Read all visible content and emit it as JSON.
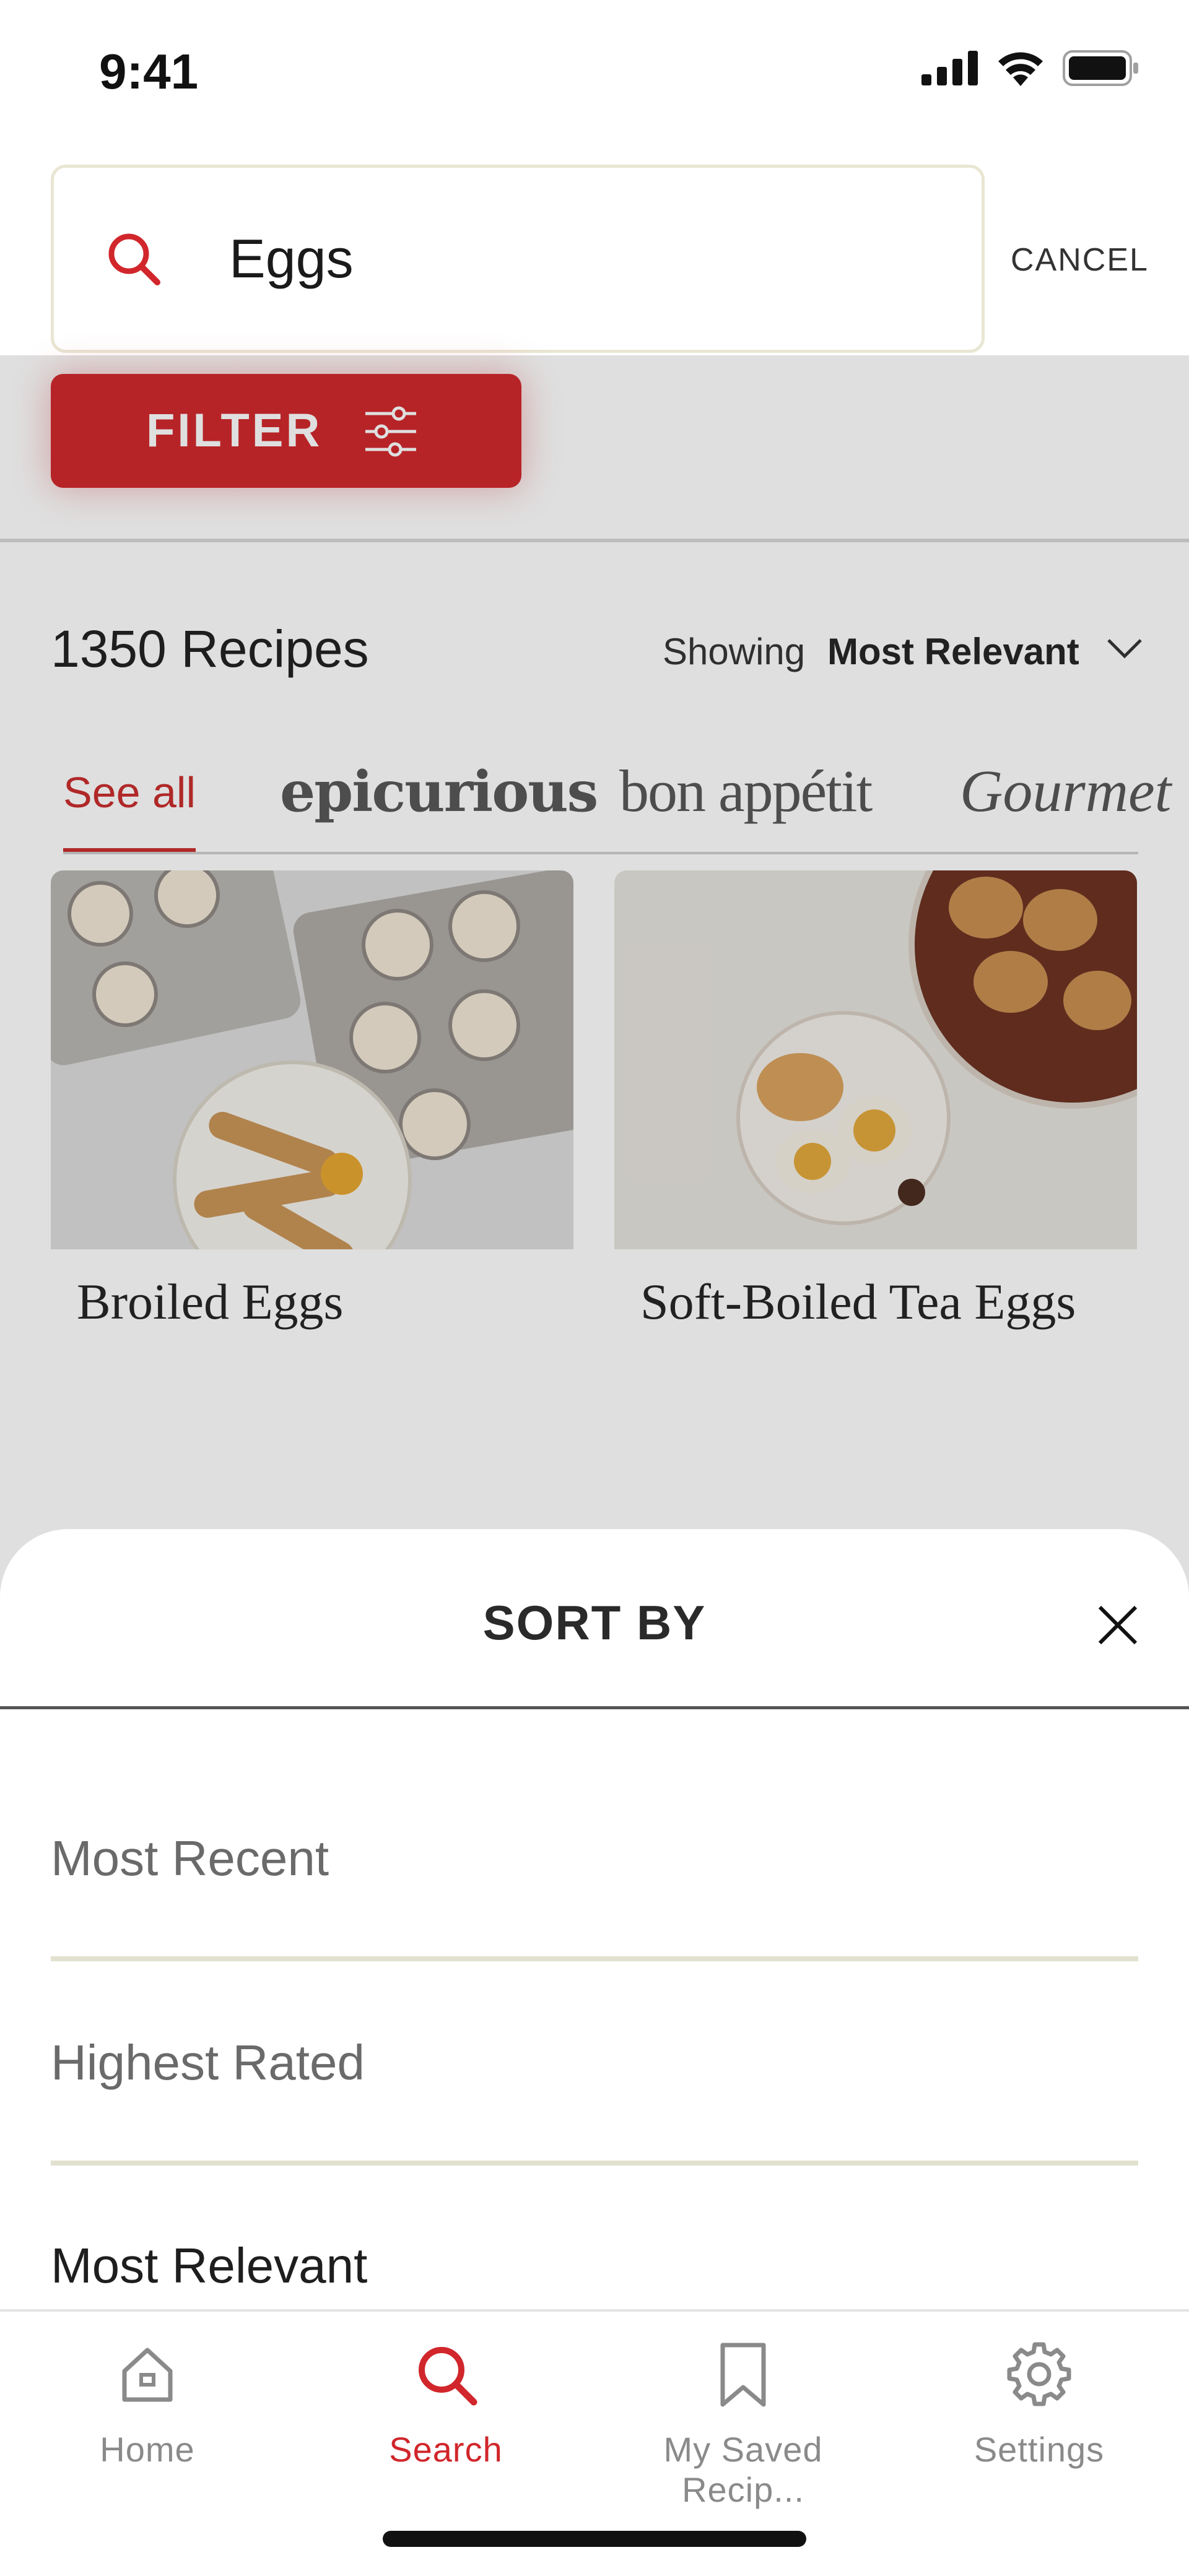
{
  "status_bar": {
    "time": "9:41"
  },
  "search": {
    "query": "Eggs",
    "cancel_label": "CANCEL"
  },
  "filter": {
    "label": "FILTER"
  },
  "results": {
    "count_label": "1350 Recipes",
    "showing_label": "Showing",
    "sort_value": "Most Relevant"
  },
  "source_tabs": [
    {
      "label": "See all",
      "active": true
    },
    {
      "label": "epicurious"
    },
    {
      "label": "bon appétit"
    },
    {
      "label": "Gourmet"
    }
  ],
  "recipes": [
    {
      "title": "Broiled Eggs"
    },
    {
      "title": "Soft-Boiled Tea Eggs"
    }
  ],
  "sort_sheet": {
    "title": "SORT BY",
    "options": [
      {
        "label": "Most Recent",
        "selected": false
      },
      {
        "label": "Highest Rated",
        "selected": false
      },
      {
        "label": "Most Relevant",
        "selected": true
      }
    ]
  },
  "tab_bar": {
    "items": [
      {
        "label": "Home",
        "icon": "home-icon",
        "active": false
      },
      {
        "label": "Search",
        "icon": "search-icon",
        "active": true
      },
      {
        "label": "My Saved Recip...",
        "icon": "bookmark-icon",
        "active": false
      },
      {
        "label": "Settings",
        "icon": "gear-icon",
        "active": false
      }
    ]
  },
  "colors": {
    "accent": "#d1262b",
    "divider": "#e2e1cf"
  }
}
